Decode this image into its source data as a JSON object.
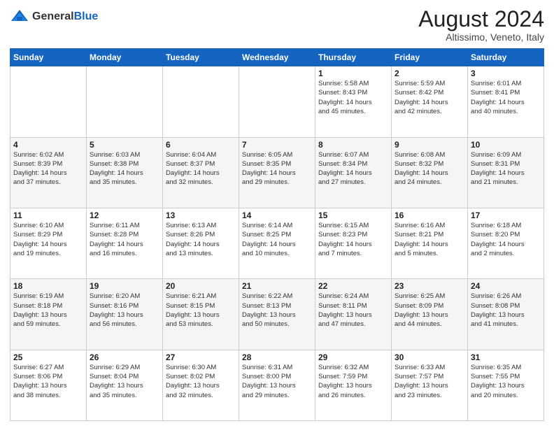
{
  "header": {
    "logo_general": "General",
    "logo_blue": "Blue",
    "month_year": "August 2024",
    "location": "Altissimo, Veneto, Italy"
  },
  "weekdays": [
    "Sunday",
    "Monday",
    "Tuesday",
    "Wednesday",
    "Thursday",
    "Friday",
    "Saturday"
  ],
  "weeks": [
    [
      {
        "day": "",
        "info": ""
      },
      {
        "day": "",
        "info": ""
      },
      {
        "day": "",
        "info": ""
      },
      {
        "day": "",
        "info": ""
      },
      {
        "day": "1",
        "info": "Sunrise: 5:58 AM\nSunset: 8:43 PM\nDaylight: 14 hours\nand 45 minutes."
      },
      {
        "day": "2",
        "info": "Sunrise: 5:59 AM\nSunset: 8:42 PM\nDaylight: 14 hours\nand 42 minutes."
      },
      {
        "day": "3",
        "info": "Sunrise: 6:01 AM\nSunset: 8:41 PM\nDaylight: 14 hours\nand 40 minutes."
      }
    ],
    [
      {
        "day": "4",
        "info": "Sunrise: 6:02 AM\nSunset: 8:39 PM\nDaylight: 14 hours\nand 37 minutes."
      },
      {
        "day": "5",
        "info": "Sunrise: 6:03 AM\nSunset: 8:38 PM\nDaylight: 14 hours\nand 35 minutes."
      },
      {
        "day": "6",
        "info": "Sunrise: 6:04 AM\nSunset: 8:37 PM\nDaylight: 14 hours\nand 32 minutes."
      },
      {
        "day": "7",
        "info": "Sunrise: 6:05 AM\nSunset: 8:35 PM\nDaylight: 14 hours\nand 29 minutes."
      },
      {
        "day": "8",
        "info": "Sunrise: 6:07 AM\nSunset: 8:34 PM\nDaylight: 14 hours\nand 27 minutes."
      },
      {
        "day": "9",
        "info": "Sunrise: 6:08 AM\nSunset: 8:32 PM\nDaylight: 14 hours\nand 24 minutes."
      },
      {
        "day": "10",
        "info": "Sunrise: 6:09 AM\nSunset: 8:31 PM\nDaylight: 14 hours\nand 21 minutes."
      }
    ],
    [
      {
        "day": "11",
        "info": "Sunrise: 6:10 AM\nSunset: 8:29 PM\nDaylight: 14 hours\nand 19 minutes."
      },
      {
        "day": "12",
        "info": "Sunrise: 6:11 AM\nSunset: 8:28 PM\nDaylight: 14 hours\nand 16 minutes."
      },
      {
        "day": "13",
        "info": "Sunrise: 6:13 AM\nSunset: 8:26 PM\nDaylight: 14 hours\nand 13 minutes."
      },
      {
        "day": "14",
        "info": "Sunrise: 6:14 AM\nSunset: 8:25 PM\nDaylight: 14 hours\nand 10 minutes."
      },
      {
        "day": "15",
        "info": "Sunrise: 6:15 AM\nSunset: 8:23 PM\nDaylight: 14 hours\nand 7 minutes."
      },
      {
        "day": "16",
        "info": "Sunrise: 6:16 AM\nSunset: 8:21 PM\nDaylight: 14 hours\nand 5 minutes."
      },
      {
        "day": "17",
        "info": "Sunrise: 6:18 AM\nSunset: 8:20 PM\nDaylight: 14 hours\nand 2 minutes."
      }
    ],
    [
      {
        "day": "18",
        "info": "Sunrise: 6:19 AM\nSunset: 8:18 PM\nDaylight: 13 hours\nand 59 minutes."
      },
      {
        "day": "19",
        "info": "Sunrise: 6:20 AM\nSunset: 8:16 PM\nDaylight: 13 hours\nand 56 minutes."
      },
      {
        "day": "20",
        "info": "Sunrise: 6:21 AM\nSunset: 8:15 PM\nDaylight: 13 hours\nand 53 minutes."
      },
      {
        "day": "21",
        "info": "Sunrise: 6:22 AM\nSunset: 8:13 PM\nDaylight: 13 hours\nand 50 minutes."
      },
      {
        "day": "22",
        "info": "Sunrise: 6:24 AM\nSunset: 8:11 PM\nDaylight: 13 hours\nand 47 minutes."
      },
      {
        "day": "23",
        "info": "Sunrise: 6:25 AM\nSunset: 8:09 PM\nDaylight: 13 hours\nand 44 minutes."
      },
      {
        "day": "24",
        "info": "Sunrise: 6:26 AM\nSunset: 8:08 PM\nDaylight: 13 hours\nand 41 minutes."
      }
    ],
    [
      {
        "day": "25",
        "info": "Sunrise: 6:27 AM\nSunset: 8:06 PM\nDaylight: 13 hours\nand 38 minutes."
      },
      {
        "day": "26",
        "info": "Sunrise: 6:29 AM\nSunset: 8:04 PM\nDaylight: 13 hours\nand 35 minutes."
      },
      {
        "day": "27",
        "info": "Sunrise: 6:30 AM\nSunset: 8:02 PM\nDaylight: 13 hours\nand 32 minutes."
      },
      {
        "day": "28",
        "info": "Sunrise: 6:31 AM\nSunset: 8:00 PM\nDaylight: 13 hours\nand 29 minutes."
      },
      {
        "day": "29",
        "info": "Sunrise: 6:32 AM\nSunset: 7:59 PM\nDaylight: 13 hours\nand 26 minutes."
      },
      {
        "day": "30",
        "info": "Sunrise: 6:33 AM\nSunset: 7:57 PM\nDaylight: 13 hours\nand 23 minutes."
      },
      {
        "day": "31",
        "info": "Sunrise: 6:35 AM\nSunset: 7:55 PM\nDaylight: 13 hours\nand 20 minutes."
      }
    ]
  ]
}
